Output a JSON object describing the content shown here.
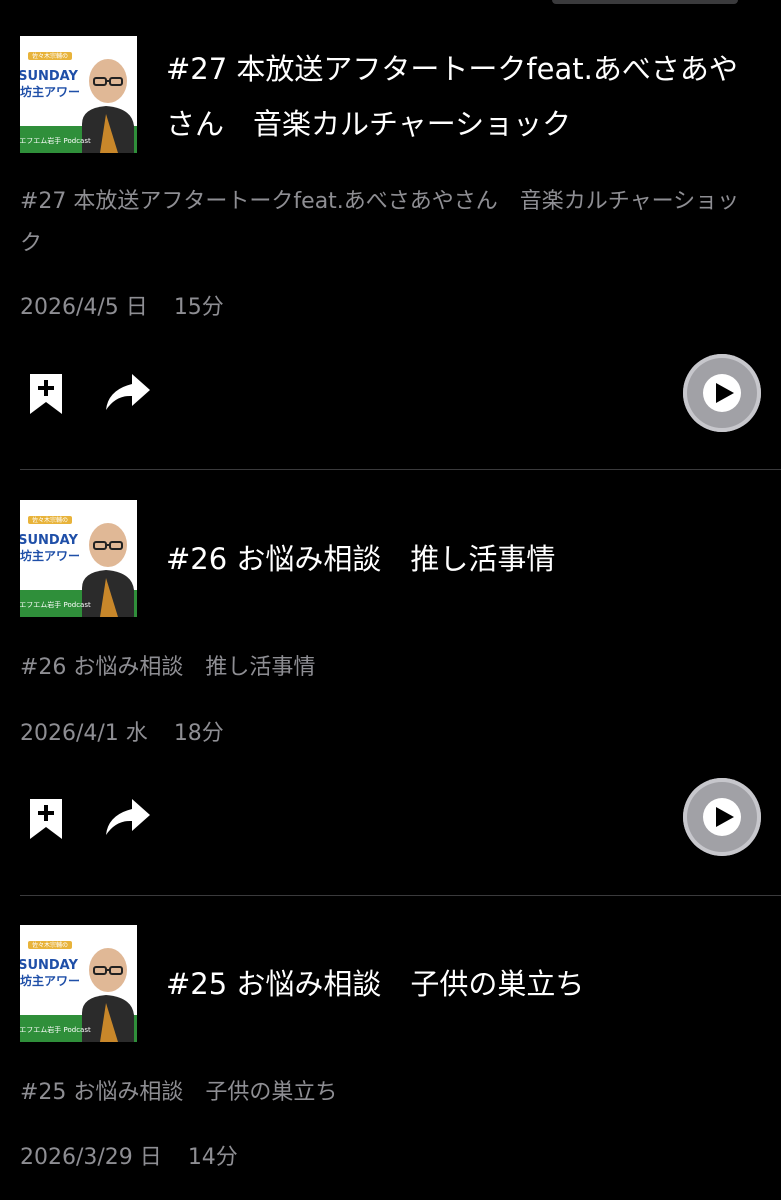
{
  "colors": {
    "background": "#000000",
    "title_text": "#ffffff",
    "secondary_text": "#8e8e93",
    "play_button": "#a1a1a6",
    "divider": "#3a3a3c"
  },
  "artwork": {
    "header": "佐々木宗輔の",
    "brand_line1": "SUNDAY",
    "brand_line2": "坊主アワー",
    "footer": "エフエム岩手 Podcast"
  },
  "actions": {
    "save_icon": "bookmark-plus-icon",
    "share_icon": "share-arrow-icon",
    "play_icon": "play-icon"
  },
  "episodes": [
    {
      "title": "#27 本放送アフタートークfeat.あべさあやさん　音楽カルチャーショック",
      "description": "#27 本放送アフタートークfeat.あべさあやさん　音楽カルチャーショック",
      "date": "2026/4/5 日",
      "duration": "15分"
    },
    {
      "title": "#26 お悩み相談　推し活事情",
      "description": "#26 お悩み相談　推し活事情",
      "date": "2026/4/1 水",
      "duration": "18分"
    },
    {
      "title": "#25 お悩み相談　子供の巣立ち",
      "description": "#25 お悩み相談　子供の巣立ち",
      "date": "2026/3/29 日",
      "duration": "14分"
    }
  ]
}
